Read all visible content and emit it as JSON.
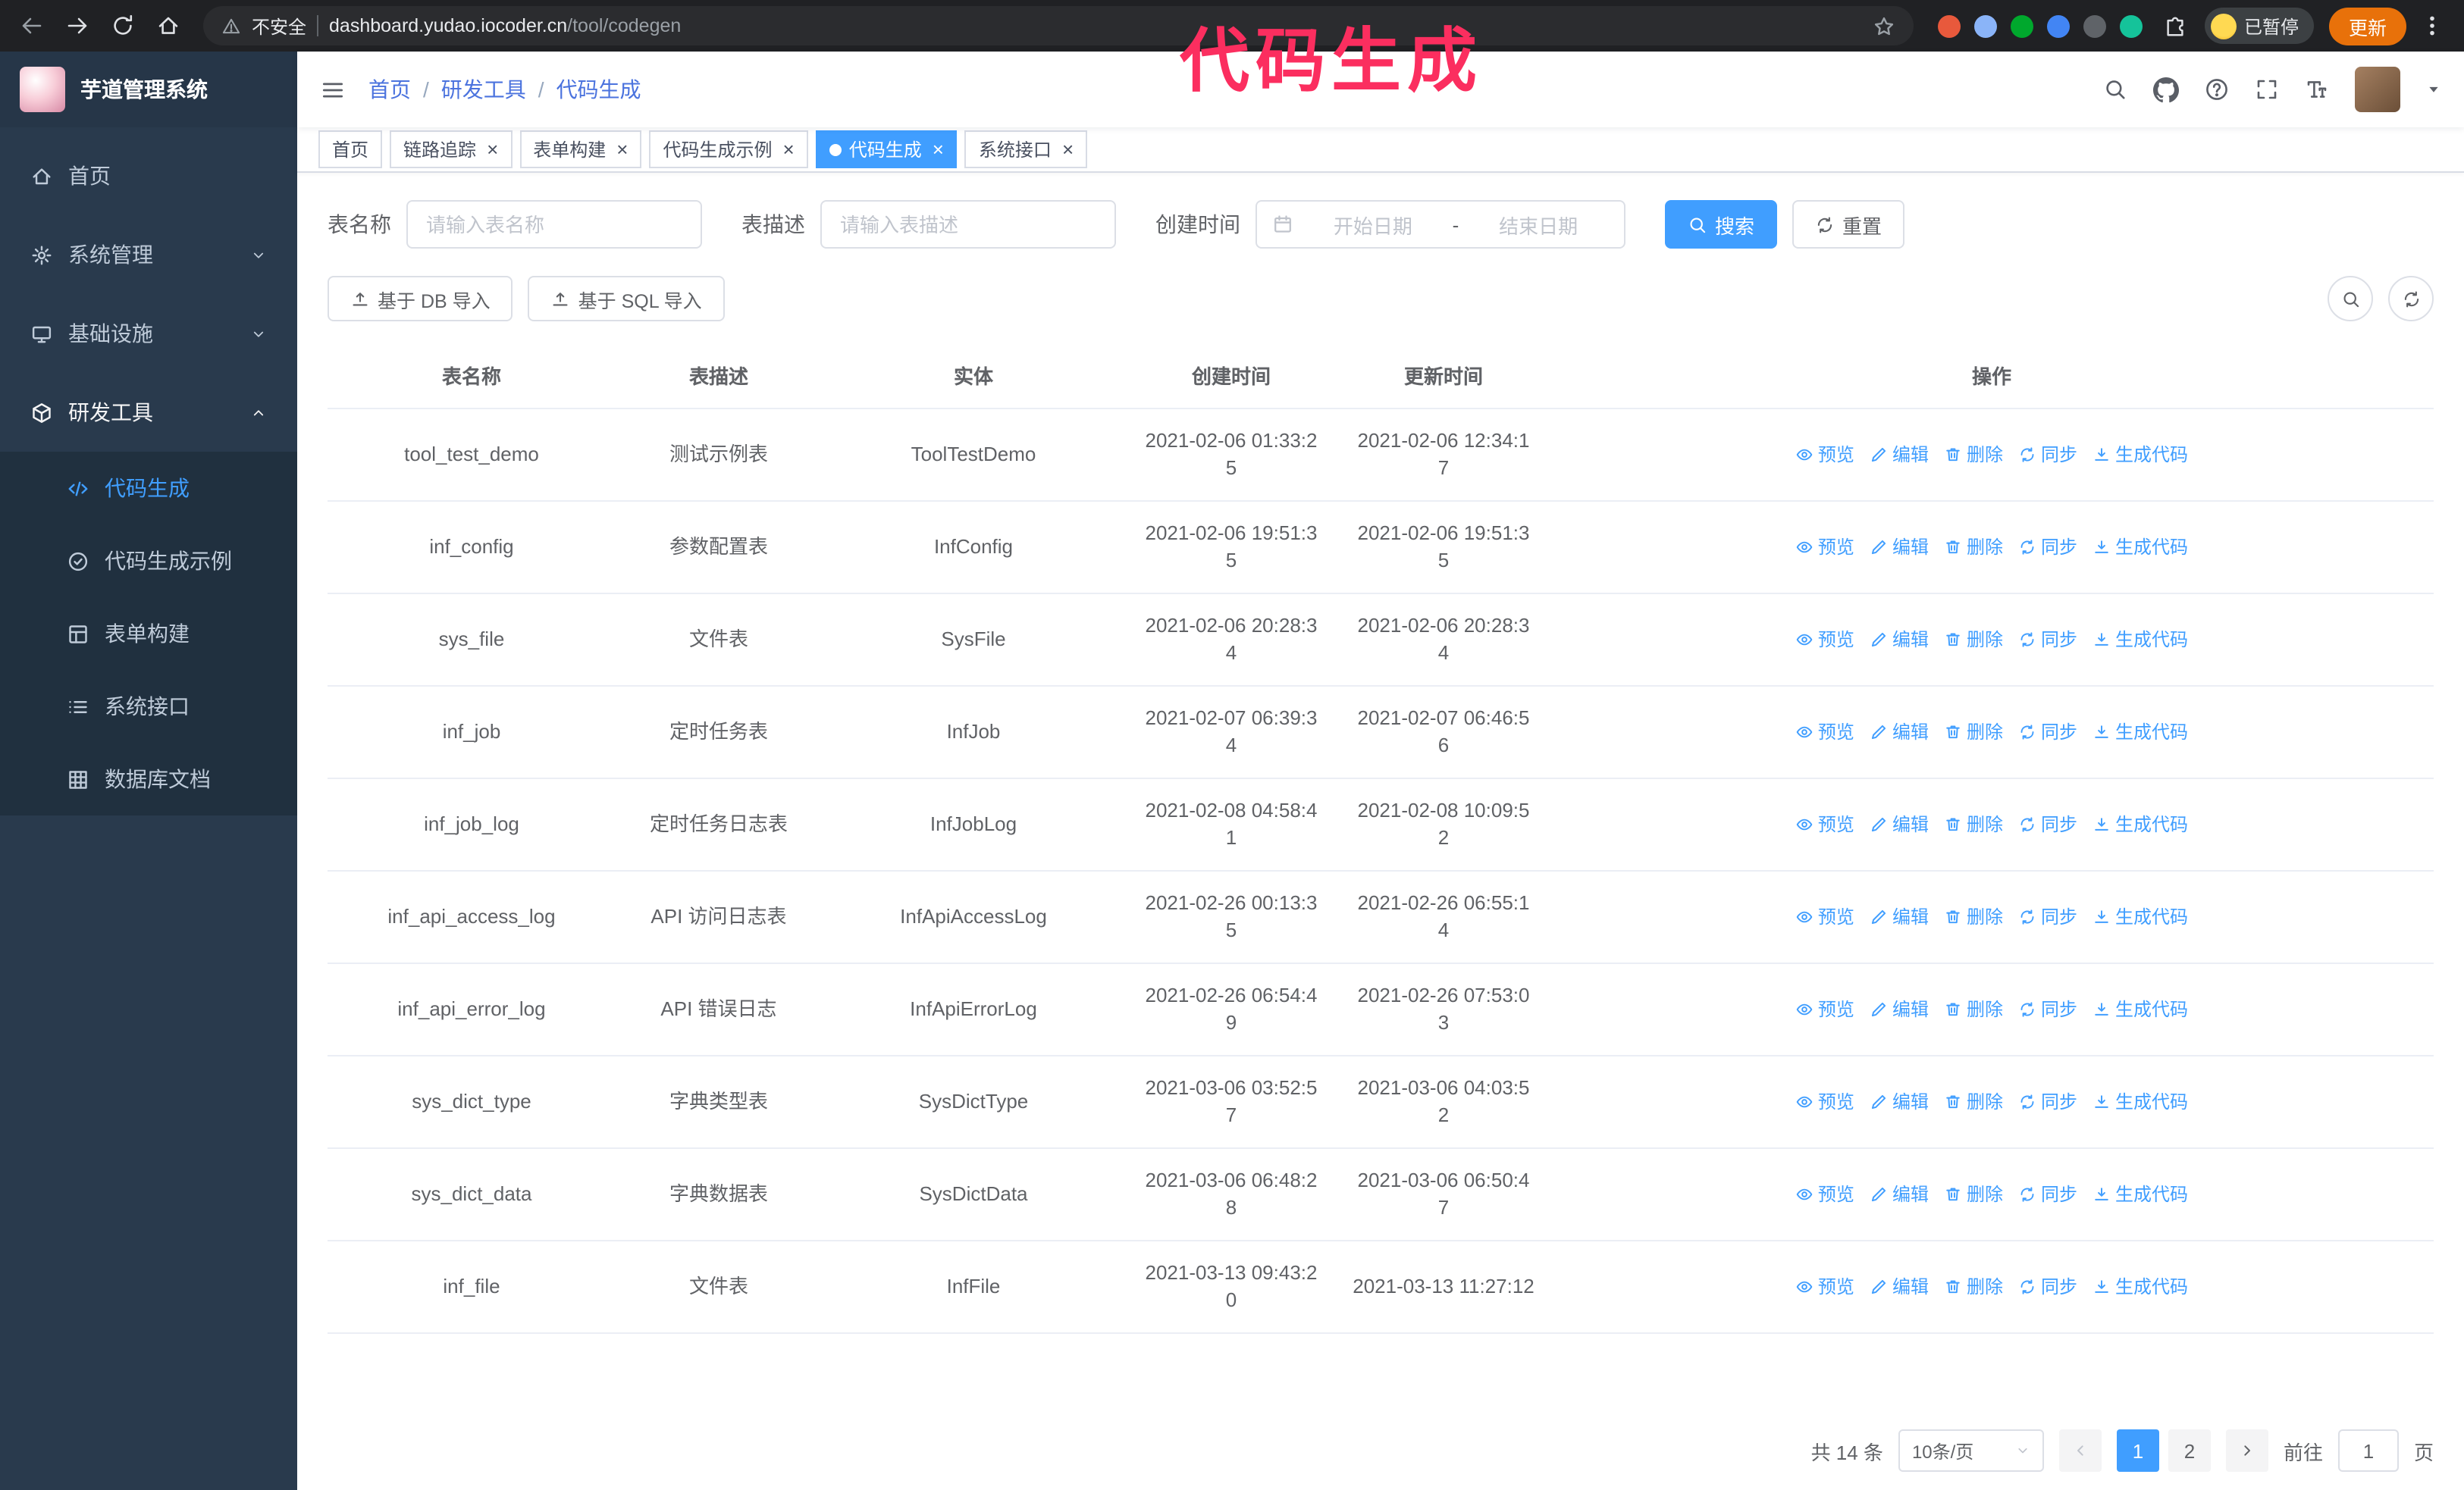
{
  "colors": {
    "primary": "#409eff",
    "annotation": "#fb2e5f",
    "update_button": "#e8710a",
    "sidebar_bg": "#293a4d"
  },
  "browser": {
    "security_label": "不安全",
    "url_domain": "dashboard.yudao.iocoder.cn",
    "url_path": "/tool/codegen",
    "extension_icons": [
      {
        "name": "browser-extension-icon-1",
        "color": "#e8593c"
      },
      {
        "name": "browser-extension-icon-2",
        "color": "#8ab4f8"
      },
      {
        "name": "browser-extension-icon-3",
        "color": "#00a82d"
      },
      {
        "name": "browser-extension-icon-4",
        "color": "#4285f4"
      },
      {
        "name": "browser-extension-icon-5",
        "color": "#5f6368"
      },
      {
        "name": "browser-extension-icon-6",
        "color": "#15c39a"
      }
    ],
    "profile_label": "已暂停",
    "update_label": "更新"
  },
  "annotation": {
    "text": "代码生成"
  },
  "ui": {
    "breadcrumb_separator": "/",
    "tab_close_glyph": "×"
  },
  "sidebar": {
    "logo_title": "芋道管理系统",
    "items": [
      {
        "key": "home",
        "label": "首页",
        "icon": "home-icon",
        "expandable": false,
        "expanded": false
      },
      {
        "key": "system-management",
        "label": "系统管理",
        "icon": "gear-icon",
        "expandable": true,
        "expanded": false
      },
      {
        "key": "infrastructure",
        "label": "基础设施",
        "icon": "monitor-icon",
        "expandable": true,
        "expanded": false
      },
      {
        "key": "dev-tools",
        "label": "研发工具",
        "icon": "cube-icon",
        "expandable": true,
        "expanded": true,
        "children": [
          {
            "key": "codegen",
            "label": "代码生成",
            "icon": "code-icon",
            "active": true
          },
          {
            "key": "codegen-example",
            "label": "代码生成示例",
            "icon": "badge-check-icon",
            "active": false
          },
          {
            "key": "form-builder",
            "label": "表单构建",
            "icon": "form-icon",
            "active": false
          },
          {
            "key": "system-api",
            "label": "系统接口",
            "icon": "list-icon",
            "active": false
          },
          {
            "key": "db-doc",
            "label": "数据库文档",
            "icon": "grid-icon",
            "active": false
          }
        ]
      }
    ]
  },
  "header": {
    "breadcrumb": [
      "首页",
      "研发工具",
      "代码生成"
    ]
  },
  "tabs": [
    {
      "key": "home",
      "label": "首页",
      "closable": false,
      "active": false
    },
    {
      "key": "tracer",
      "label": "链路追踪",
      "closable": true,
      "active": false
    },
    {
      "key": "form-builder",
      "label": "表单构建",
      "closable": true,
      "active": false
    },
    {
      "key": "codegen-example",
      "label": "代码生成示例",
      "closable": true,
      "active": false
    },
    {
      "key": "codegen",
      "label": "代码生成",
      "closable": true,
      "active": true
    },
    {
      "key": "system-api",
      "label": "系统接口",
      "closable": true,
      "active": false
    }
  ],
  "filters": {
    "table_name_label": "表名称",
    "table_name_placeholder": "请输入表名称",
    "table_desc_label": "表描述",
    "table_desc_placeholder": "请输入表描述",
    "create_time_label": "创建时间",
    "date_start_placeholder": "开始日期",
    "date_separator": "-",
    "date_end_placeholder": "结束日期",
    "search_label": "搜索",
    "reset_label": "重置"
  },
  "toolbar": {
    "import_db_label": "基于 DB 导入",
    "import_sql_label": "基于 SQL 导入"
  },
  "table": {
    "columns": [
      "表名称",
      "表描述",
      "实体",
      "创建时间",
      "更新时间",
      "操作"
    ],
    "actions": [
      {
        "key": "preview",
        "label": "预览",
        "icon": "eye-icon"
      },
      {
        "key": "edit",
        "label": "编辑",
        "icon": "edit-icon"
      },
      {
        "key": "delete",
        "label": "删除",
        "icon": "delete-icon"
      },
      {
        "key": "sync",
        "label": "同步",
        "icon": "sync-icon"
      },
      {
        "key": "generate",
        "label": "生成代码",
        "icon": "download-icon"
      }
    ],
    "rows": [
      {
        "name": "tool_test_demo",
        "desc": "测试示例表",
        "entity": "ToolTestDemo",
        "created": "2021-02-06 01:33:25",
        "updated": "2021-02-06 12:34:17"
      },
      {
        "name": "inf_config",
        "desc": "参数配置表",
        "entity": "InfConfig",
        "created": "2021-02-06 19:51:35",
        "updated": "2021-02-06 19:51:35"
      },
      {
        "name": "sys_file",
        "desc": "文件表",
        "entity": "SysFile",
        "created": "2021-02-06 20:28:34",
        "updated": "2021-02-06 20:28:34"
      },
      {
        "name": "inf_job",
        "desc": "定时任务表",
        "entity": "InfJob",
        "created": "2021-02-07 06:39:34",
        "updated": "2021-02-07 06:46:56"
      },
      {
        "name": "inf_job_log",
        "desc": "定时任务日志表",
        "entity": "InfJobLog",
        "created": "2021-02-08 04:58:41",
        "updated": "2021-02-08 10:09:52"
      },
      {
        "name": "inf_api_access_log",
        "desc": "API 访问日志表",
        "entity": "InfApiAccessLog",
        "created": "2021-02-26 00:13:35",
        "updated": "2021-02-26 06:55:14"
      },
      {
        "name": "inf_api_error_log",
        "desc": "API 错误日志",
        "entity": "InfApiErrorLog",
        "created": "2021-02-26 06:54:49",
        "updated": "2021-02-26 07:53:03"
      },
      {
        "name": "sys_dict_type",
        "desc": "字典类型表",
        "entity": "SysDictType",
        "created": "2021-03-06 03:52:57",
        "updated": "2021-03-06 04:03:52"
      },
      {
        "name": "sys_dict_data",
        "desc": "字典数据表",
        "entity": "SysDictData",
        "created": "2021-03-06 06:48:28",
        "updated": "2021-03-06 06:50:47"
      },
      {
        "name": "inf_file",
        "desc": "文件表",
        "entity": "InfFile",
        "created": "2021-03-13 09:43:20",
        "updated": "2021-03-13 11:27:12"
      }
    ]
  },
  "pagination": {
    "total_label": "共 14 条",
    "page_size_label": "10条/页",
    "pages": [
      "1",
      "2"
    ],
    "active_page": "1",
    "goto_prefix": "前往",
    "goto_value": "1",
    "goto_suffix": "页"
  }
}
